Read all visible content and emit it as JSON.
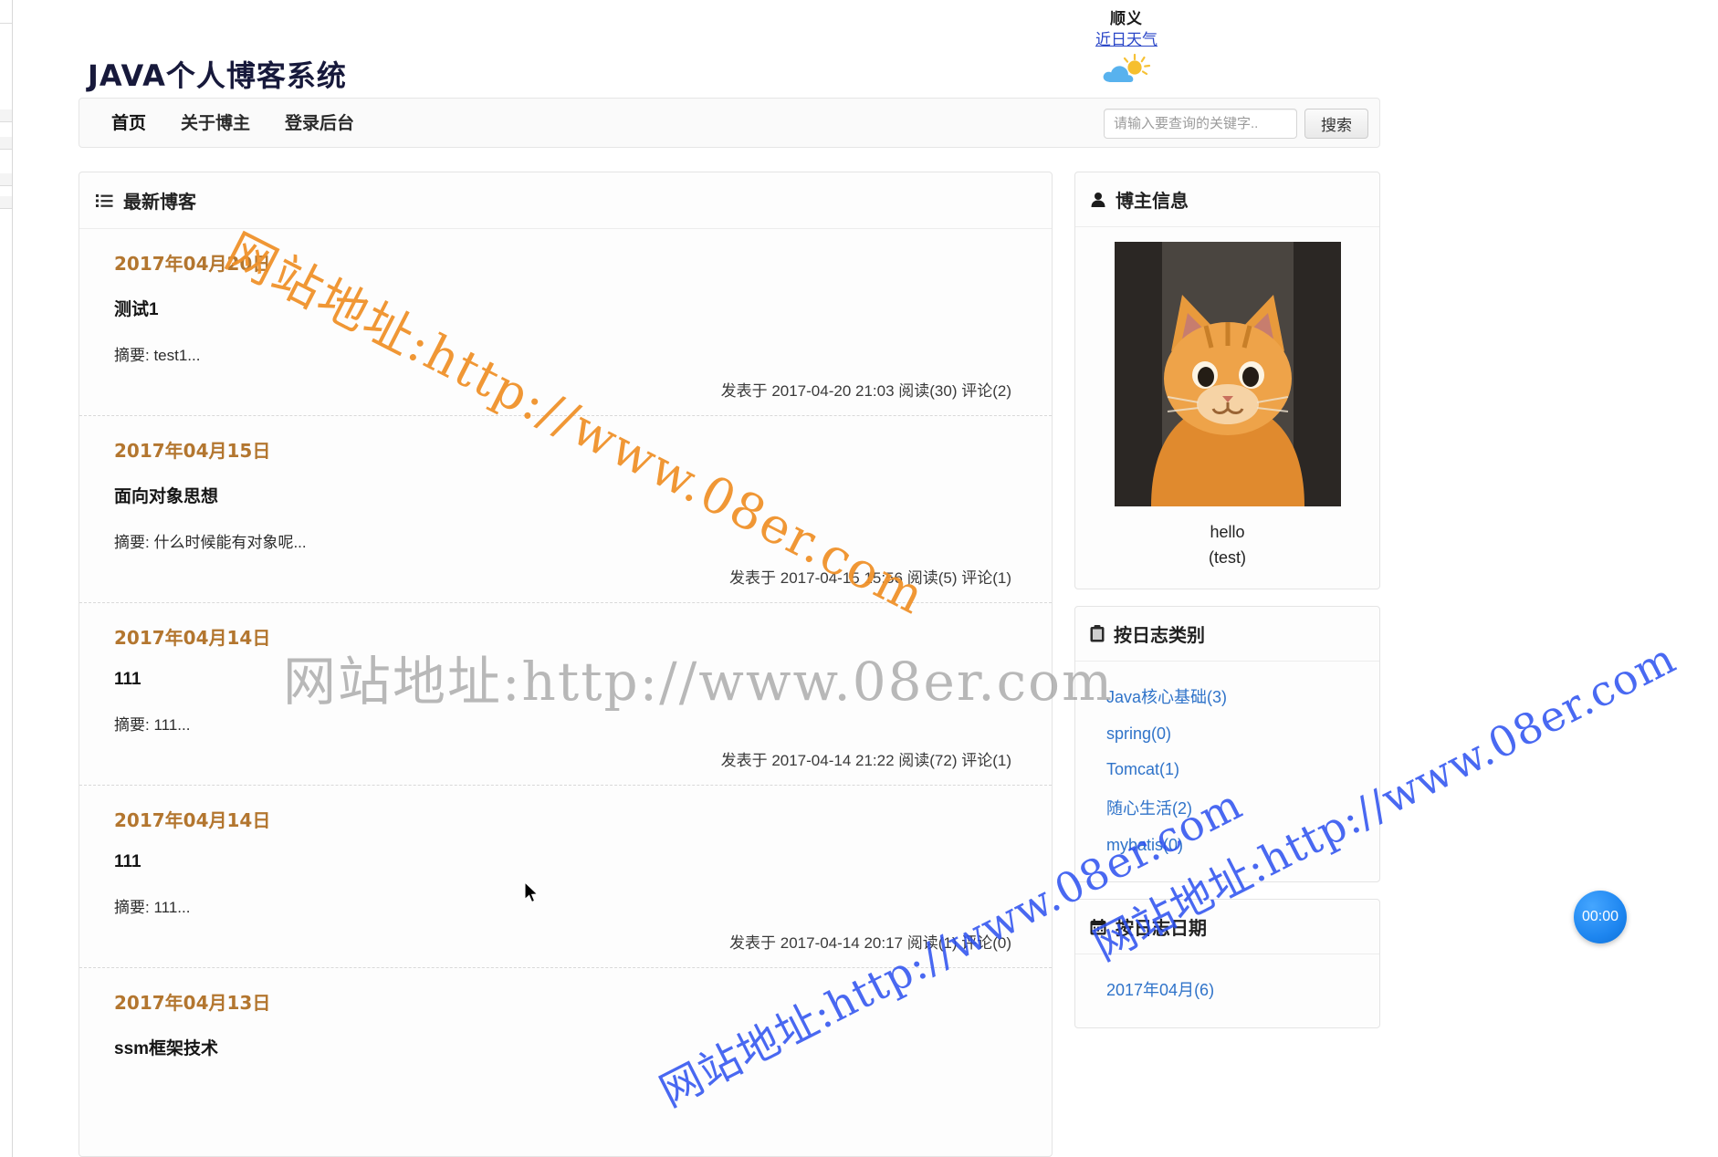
{
  "site": {
    "logo_text": "JAVA个人博客系统"
  },
  "weather": {
    "city": "顺义",
    "link_label": "近日天气",
    "icon": "sun-behind-cloud-icon"
  },
  "nav": {
    "items": [
      {
        "label": "首页",
        "active": true
      },
      {
        "label": "关于博主",
        "active": false
      },
      {
        "label": "登录后台",
        "active": false
      }
    ]
  },
  "search": {
    "placeholder": "请输入要查询的关键字..",
    "value": "",
    "button_label": "搜索"
  },
  "main": {
    "panel_title": "最新博客",
    "panel_icon": "list-icon",
    "posts": [
      {
        "date": "2017年04月20日",
        "title": "测试1",
        "summary": "摘要: test1...",
        "meta": "发表于 2017-04-20 21:03 阅读(30) 评论(2)"
      },
      {
        "date": "2017年04月15日",
        "title": "面向对象思想",
        "summary": "摘要: 什么时候能有对象呢...",
        "meta": "发表于 2017-04-15 15:56 阅读(5) 评论(1)"
      },
      {
        "date": "2017年04月14日",
        "title": "111",
        "summary": "摘要: 111...",
        "meta": "发表于 2017-04-14 21:22 阅读(72) 评论(1)"
      },
      {
        "date": "2017年04月14日",
        "title": "111",
        "summary": "摘要: 111...",
        "meta": "发表于 2017-04-14 20:17 阅读(1) 评论(0)"
      },
      {
        "date": "2017年04月13日",
        "title": "ssm框架技术",
        "summary": "",
        "meta": ""
      }
    ]
  },
  "sidebar": {
    "blogger": {
      "title": "博主信息",
      "icon": "user-icon",
      "avatar_alt": "orange-cat-avatar",
      "name": "hello",
      "sub": "(test)"
    },
    "categories": {
      "title": "按日志类别",
      "icon": "clipboard-icon",
      "items": [
        {
          "label": "Java核心基础(3)"
        },
        {
          "label": "spring(0)"
        },
        {
          "label": "Tomcat(1)"
        },
        {
          "label": "随心生活(2)"
        },
        {
          "label": "mybatis(0)"
        }
      ]
    },
    "archive": {
      "title": "按日志日期",
      "icon": "calendar-icon",
      "items": [
        {
          "label": "2017年04月(6)"
        }
      ]
    }
  },
  "overlays": {
    "watermarks": [
      "网站地址:http://www.08er.com",
      "网站地址:http://www.08er.com",
      "网站地址:http://www.08er.com",
      "网站地址:http://www.08er.com"
    ],
    "timer_badge": "00:00"
  },
  "colors": {
    "accent_orange": "#b3762f",
    "link_blue": "#2f73c9",
    "watermark_orange": "#f0922b",
    "watermark_blue": "#2a4ff0",
    "badge_blue": "#1e86f0"
  }
}
